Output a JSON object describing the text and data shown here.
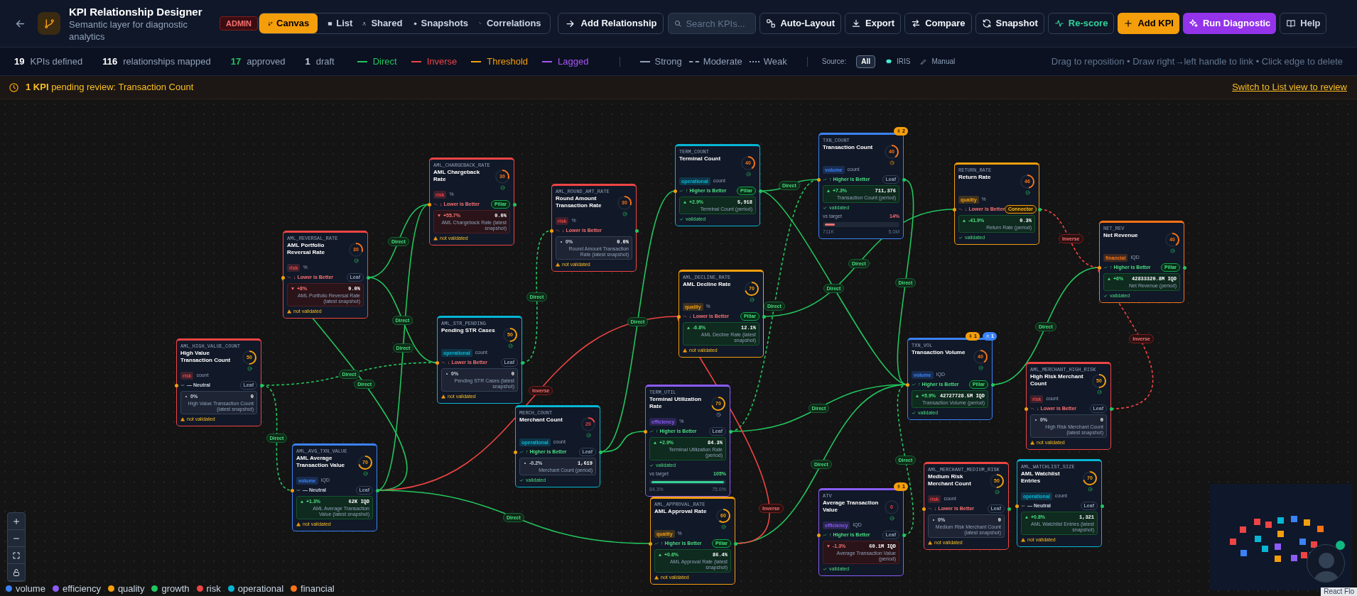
{
  "header": {
    "title": "KPI Relationship Designer",
    "subtitle": "Semantic layer for diagnostic analytics",
    "role_badge": "ADMIN",
    "tabs": [
      {
        "label": "Canvas",
        "kind": "canvas",
        "selected": true
      },
      {
        "label": "List",
        "kind": "list",
        "selected": false
      },
      {
        "label": "Shared",
        "kind": "shared",
        "selected": false
      },
      {
        "label": "Snapshots",
        "kind": "snapshots",
        "selected": false
      },
      {
        "label": "Correlations",
        "kind": "correlations",
        "selected": false
      }
    ],
    "add_relationship": "Add Relationship",
    "search": {
      "placeholder": "Search KPIs..."
    },
    "buttons": [
      {
        "label": "Auto-Layout",
        "kind": "auto_layout"
      },
      {
        "label": "Export",
        "kind": "export"
      },
      {
        "label": "Compare",
        "kind": "compare"
      },
      {
        "label": "Snapshot",
        "kind": "snapshot"
      },
      {
        "label": "Re-score",
        "kind": "rescore"
      },
      {
        "label": "Add KPI",
        "kind": "add_kpi"
      },
      {
        "label": "Run Diagnostic",
        "kind": "run_diagnostic"
      },
      {
        "label": "Help",
        "kind": "help"
      }
    ]
  },
  "stats": [
    {
      "value": "19",
      "label": "KPIs defined",
      "color": "#ffffff"
    },
    {
      "value": "116",
      "label": "relationships mapped",
      "color": "#ffffff"
    },
    {
      "value": "17",
      "label": "approved",
      "color": "#22c55e"
    },
    {
      "value": "1",
      "label": "draft",
      "color": "#cbd5e1"
    }
  ],
  "edge_types": [
    {
      "label": "Direct",
      "color": "#22c55e"
    },
    {
      "label": "Inverse",
      "color": "#ef4444"
    },
    {
      "label": "Threshold",
      "color": "#f59e0b"
    },
    {
      "label": "Lagged",
      "color": "#a855f7"
    }
  ],
  "strengths": [
    {
      "label": "Strong",
      "kind": "solid"
    },
    {
      "label": "Moderate",
      "kind": "dashed"
    },
    {
      "label": "Weak",
      "kind": "dotted"
    }
  ],
  "source": {
    "label": "Source:",
    "options": [
      {
        "label": "All",
        "kind": "all",
        "selected": true
      },
      {
        "label": "IRIS",
        "kind": "iris",
        "selected": false
      },
      {
        "label": "Manual",
        "kind": "manual",
        "selected": false
      }
    ]
  },
  "hint": "Drag to reposition • Draw right→left handle to link • Click edge to delete",
  "banner": {
    "message": "**1 KPI** pending review: Transaction Count",
    "link": "Switch to List view to review"
  },
  "nodes": [
    {
      "code": "AML_HIGH_VALUE_COUNT",
      "name": "High Value Transaction Count",
      "score": "50",
      "status": {
        "kind": "approved"
      },
      "tag": {
        "label": "risk",
        "color": "#ef4444"
      },
      "unit": "count",
      "direction": {
        "label": "— Neutral",
        "kind": "neutral"
      },
      "role": {
        "label": "Leaf",
        "kind": "leaf"
      },
      "change": {
        "label": "0%",
        "kind": "flat"
      },
      "value": "0",
      "note": "High Value Transaction Count (latest snapshot)",
      "validation": {
        "label": "not validated",
        "ok": false
      }
    },
    {
      "code": "AML_REVERSAL_RATE",
      "name": "AML Portfolio Reversal Rate",
      "score": "30",
      "status": {
        "kind": "approved"
      },
      "tag": {
        "label": "risk",
        "color": "#ef4444"
      },
      "unit": "%",
      "direction": {
        "label": "↓ Lower is Better",
        "kind": "lower"
      },
      "role": {
        "label": "Leaf",
        "kind": "leaf"
      },
      "change": {
        "label": "+8%",
        "kind": "bad"
      },
      "value": "0.0%",
      "note": "AML Portfolio Reversal Rate (latest snapshot)",
      "validation": {
        "label": "not validated",
        "ok": false
      }
    },
    {
      "code": "AML_CHARGEBACK_RATE",
      "name": "AML Chargeback Rate",
      "score": "30",
      "status": {
        "kind": "approved"
      },
      "tag": {
        "label": "risk",
        "color": "#ef4444"
      },
      "unit": "%",
      "direction": {
        "label": "↓ Lower is Better",
        "kind": "lower"
      },
      "role": {
        "label": "Pillar",
        "kind": "pillar"
      },
      "change": {
        "label": "+55.7%",
        "kind": "bad"
      },
      "value": "0.0%",
      "note": "AML Chargeback Rate (latest snapshot)",
      "validation": {
        "label": "not validated",
        "ok": false
      }
    },
    {
      "code": "AML_ROUND_AMT_RATE",
      "name": "Round Amount Transaction Rate",
      "score": "30",
      "status": {
        "kind": "approved"
      },
      "tag": {
        "label": "risk",
        "color": "#ef4444"
      },
      "unit": "%",
      "direction": {
        "label": "↓ Lower is Better",
        "kind": "lower"
      },
      "change": {
        "label": "0%",
        "kind": "flat"
      },
      "value": "0.0%",
      "note": "Round Amount Transaction Rate (latest snapshot)",
      "validation": {
        "label": "not validated",
        "ok": false
      }
    },
    {
      "code": "AML_STR_PENDING",
      "name": "Pending STR Cases",
      "score": "50",
      "status": {
        "kind": "approved"
      },
      "tag": {
        "label": "operational",
        "color": "#06b6d4"
      },
      "unit": "count",
      "direction": {
        "label": "↓ Lower is Better",
        "kind": "lower"
      },
      "role": {
        "label": "Leaf",
        "kind": "leaf"
      },
      "change": {
        "label": "0%",
        "kind": "flat"
      },
      "value": "0",
      "note": "Pending STR Cases (latest snapshot)",
      "validation": {
        "label": "not validated",
        "ok": false
      }
    },
    {
      "code": "TERM_COUNT",
      "name": "Terminal Count",
      "score": "40",
      "status": {
        "kind": "approved"
      },
      "tag": {
        "label": "operational",
        "color": "#06b6d4"
      },
      "unit": "count",
      "direction": {
        "label": "↑ Higher is Better",
        "kind": "higher"
      },
      "role": {
        "label": "Pillar",
        "kind": "pillar"
      },
      "change": {
        "label": "+2.9%",
        "kind": "good"
      },
      "value": "5,918",
      "note": "Terminal Count (period)",
      "validation": {
        "label": "validated",
        "ok": true
      }
    },
    {
      "code": "TXN_COUNT",
      "name": "Transaction Count",
      "score": "40",
      "status": {
        "kind": "review"
      },
      "badges": [
        {
          "kind": "pin",
          "count": "2"
        }
      ],
      "tag": {
        "label": "volume",
        "color": "#3b82f6"
      },
      "unit": "count",
      "direction": {
        "label": "↑ Higher is Better",
        "kind": "higher"
      },
      "role": {
        "label": "Leaf",
        "kind": "leaf"
      },
      "change": {
        "label": "+7.3%",
        "kind": "good"
      },
      "value": "711,376",
      "note": "Transaction Count (period)",
      "validation": {
        "label": "validated",
        "ok": true
      },
      "target": {
        "label": "vs target",
        "reading": "14%",
        "level": 0.14,
        "met": false,
        "min": "711K",
        "max": "5.0M"
      }
    },
    {
      "code": "RETURN_RATE",
      "name": "Return Rate",
      "score": "46",
      "status": {
        "kind": "approved"
      },
      "tag": {
        "label": "quality",
        "color": "#f59e0b"
      },
      "unit": "%",
      "direction": {
        "label": "↓ Lower is Better",
        "kind": "lower"
      },
      "role": {
        "label": "Connector",
        "kind": "connector"
      },
      "change": {
        "label": "-41.9%",
        "kind": "good"
      },
      "value": "0.3%",
      "note": "Return Rate (period)",
      "validation": {
        "label": "validated",
        "ok": true
      }
    },
    {
      "code": "NET_REV",
      "name": "Net Revenue",
      "score": "40",
      "status": {
        "kind": "approved"
      },
      "tag": {
        "label": "financial",
        "color": "#f97316"
      },
      "unit": "IQD",
      "direction": {
        "label": "↑ Higher is Better",
        "kind": "higher"
      },
      "role": {
        "label": "Pillar",
        "kind": "pillar"
      },
      "change": {
        "label": "+6%",
        "kind": "good"
      },
      "value": "42833320.8M IQD",
      "note": "Net Revenue (period)",
      "validation": {
        "label": "validated",
        "ok": true
      }
    },
    {
      "code": "AML_DECLINE_RATE",
      "name": "AML Decline Rate",
      "score": "70",
      "status": {
        "kind": "approved"
      },
      "tag": {
        "label": "quality",
        "color": "#f59e0b"
      },
      "unit": "%",
      "direction": {
        "label": "↓ Lower is Better",
        "kind": "lower"
      },
      "role": {
        "label": "Pillar",
        "kind": "pillar"
      },
      "change": {
        "label": "-6.8%",
        "kind": "good"
      },
      "value": "12.1%",
      "note": "AML Decline Rate (latest snapshot)",
      "validation": {
        "label": "not validated",
        "ok": false
      }
    },
    {
      "code": "TXN_VOL",
      "name": "Transaction Volume",
      "score": "40",
      "status": {
        "kind": "approved"
      },
      "badges": [
        {
          "kind": "pin",
          "count": "1"
        },
        {
          "kind": "user",
          "count": "1"
        }
      ],
      "tag": {
        "label": "volume",
        "color": "#3b82f6"
      },
      "unit": "IQD",
      "direction": {
        "label": "↑ Higher is Better",
        "kind": "higher"
      },
      "role": {
        "label": "Pillar",
        "kind": "pillar"
      },
      "change": {
        "label": "+5.9%",
        "kind": "good"
      },
      "value": "42727728.5M IQD",
      "note": "Transaction Volume (period)",
      "validation": {
        "label": "validated",
        "ok": true
      }
    },
    {
      "code": "AML_MERCHANT_HIGH_RISK",
      "name": "High Risk Merchant Count",
      "score": "50",
      "status": {
        "kind": "approved"
      },
      "tag": {
        "label": "risk",
        "color": "#ef4444"
      },
      "unit": "count",
      "direction": {
        "label": "↓ Lower is Better",
        "kind": "lower"
      },
      "role": {
        "label": "Leaf",
        "kind": "leaf"
      },
      "change": {
        "label": "0%",
        "kind": "flat"
      },
      "value": "0",
      "note": "High Risk Merchant Count (latest snapshot)",
      "validation": {
        "label": "not validated",
        "ok": false
      }
    },
    {
      "code": "MERCH_COUNT",
      "name": "Merchant Count",
      "score": "20",
      "status": {
        "kind": "approved"
      },
      "tag": {
        "label": "operational",
        "color": "#06b6d4"
      },
      "unit": "count",
      "direction": {
        "label": "↑ Higher is Better",
        "kind": "higher"
      },
      "role": {
        "label": "Leaf",
        "kind": "leaf"
      },
      "change": {
        "label": "-0.2%",
        "kind": "flat"
      },
      "value": "1,619",
      "note": "Merchant Count (period)",
      "validation": {
        "label": "validated",
        "ok": true
      }
    },
    {
      "code": "TERM_UTIL",
      "name": "Terminal Utilization Rate",
      "score": "70",
      "status": {
        "kind": "draft"
      },
      "tag": {
        "label": "efficiency",
        "color": "#8b5cf6"
      },
      "unit": "%",
      "direction": {
        "label": "↑ Higher is Better",
        "kind": "higher"
      },
      "role": {
        "label": "Leaf",
        "kind": "leaf"
      },
      "change": {
        "label": "+2.9%",
        "kind": "good"
      },
      "value": "84.3%",
      "note": "Terminal Utilization Rate (period)",
      "validation": {
        "label": "validated",
        "ok": true
      },
      "target": {
        "label": "vs target",
        "reading": "105%",
        "level": 1,
        "met": true,
        "min": "84.3%",
        "max": "75.0%"
      }
    },
    {
      "code": "AML_AVG_TXN_VALUE",
      "name": "AML Average Transaction Value",
      "score": "70",
      "status": {
        "kind": "approved"
      },
      "tag": {
        "label": "volume",
        "color": "#3b82f6"
      },
      "unit": "IQD",
      "direction": {
        "label": "— Neutral",
        "kind": "neutral"
      },
      "role": {
        "label": "Leaf",
        "kind": "leaf"
      },
      "change": {
        "label": "+1.3%",
        "kind": "good"
      },
      "value": "62K IQD",
      "note": "AML Average Transaction Value (latest snapshot)",
      "validation": {
        "label": "not validated",
        "ok": false
      }
    },
    {
      "code": "AML_APPROVAL_RATE",
      "name": "AML Approval Rate",
      "score": "60",
      "status": {
        "kind": "approved"
      },
      "tag": {
        "label": "quality",
        "color": "#f59e0b"
      },
      "unit": "%",
      "direction": {
        "label": "↑ Higher is Better",
        "kind": "higher"
      },
      "role": {
        "label": "Pillar",
        "kind": "pillar"
      },
      "change": {
        "label": "+0.6%",
        "kind": "good"
      },
      "value": "86.4%",
      "note": "AML Approval Rate (latest snapshot)",
      "validation": {
        "label": "not validated",
        "ok": false
      }
    },
    {
      "code": "ATV",
      "name": "Average Transaction Value",
      "score": "0",
      "status": {
        "kind": "approved"
      },
      "badges": [
        {
          "kind": "pin",
          "count": "1"
        }
      ],
      "tag": {
        "label": "efficiency",
        "color": "#8b5cf6"
      },
      "unit": "IQD",
      "direction": {
        "label": "↑ Higher is Better",
        "kind": "higher"
      },
      "role": {
        "label": "Leaf",
        "kind": "leaf"
      },
      "change": {
        "label": "-1.3%",
        "kind": "bad"
      },
      "value": "60.1M IQD",
      "note": "Average Transaction Value (period)",
      "validation": {
        "label": "validated",
        "ok": true
      }
    },
    {
      "code": "AML_MERCHANT_MEDIUM_RISK",
      "name": "Medium Risk Merchant Count",
      "score": "50",
      "status": {
        "kind": "approved"
      },
      "tag": {
        "label": "risk",
        "color": "#ef4444"
      },
      "unit": "count",
      "direction": {
        "label": "↓ Lower is Better",
        "kind": "lower"
      },
      "role": {
        "label": "Leaf",
        "kind": "leaf"
      },
      "change": {
        "label": "0%",
        "kind": "flat"
      },
      "value": "0",
      "note": "Medium Risk Merchant Count (latest snapshot)",
      "validation": {
        "label": "not validated",
        "ok": false
      }
    },
    {
      "code": "AML_WATCHLIST_SIZE",
      "name": "AML Watchlist Entries",
      "score": "70",
      "status": {
        "kind": "approved"
      },
      "tag": {
        "label": "operational",
        "color": "#06b6d4"
      },
      "unit": "count",
      "direction": {
        "label": "— Neutral",
        "kind": "neutral"
      },
      "role": {
        "label": "Leaf",
        "kind": "leaf"
      },
      "change": {
        "label": "+0.8%",
        "kind": "good"
      },
      "value": "1,321",
      "note": "AML Watchlist Entries (latest snapshot)",
      "validation": {
        "label": "not validated",
        "ok": false
      }
    }
  ],
  "edges": [
    {
      "label": "Direct",
      "kind": "direct",
      "dashed": false
    },
    {
      "label": "Direct",
      "kind": "direct",
      "dashed": false
    },
    {
      "label": "Direct",
      "kind": "direct",
      "dashed": false
    },
    {
      "label": "Direct",
      "kind": "direct",
      "dashed": true
    },
    {
      "label": "Direct",
      "kind": "direct",
      "dashed": false
    },
    {
      "label": "Direct",
      "kind": "direct",
      "dashed": true
    },
    {
      "label": "Direct",
      "kind": "direct",
      "dashed": true
    },
    {
      "label": "Inverse",
      "kind": "inverse",
      "dashed": false
    },
    {
      "label": "Direct",
      "kind": "direct",
      "dashed": false
    },
    {
      "label": "Direct",
      "kind": "direct",
      "dashed": false
    },
    {
      "kind": "direct",
      "dashed": false
    },
    {
      "label": "Direct",
      "kind": "direct",
      "dashed": false
    },
    {
      "label": "Direct",
      "kind": "direct",
      "dashed": false
    },
    {
      "label": "Direct",
      "kind": "direct",
      "dashed": false
    },
    {
      "label": "Direct",
      "kind": "direct",
      "dashed": true
    },
    {
      "label": "Direct",
      "kind": "direct",
      "dashed": false
    },
    {
      "label": "Direct",
      "kind": "direct",
      "dashed": false
    },
    {
      "label": "Inverse",
      "kind": "inverse",
      "dashed": true
    },
    {
      "label": "Inverse",
      "kind": "inverse",
      "dashed": true
    },
    {
      "label": "Direct",
      "kind": "direct",
      "dashed": false
    },
    {
      "label": "Direct",
      "kind": "direct",
      "dashed": true
    },
    {
      "label": "Direct",
      "kind": "direct",
      "dashed": false
    },
    {
      "label": "Inverse",
      "kind": "inverse",
      "dashed": false
    }
  ],
  "legend": [
    {
      "label": "volume",
      "color": "#3b82f6"
    },
    {
      "label": "efficiency",
      "color": "#8b5cf6"
    },
    {
      "label": "quality",
      "color": "#f59e0b"
    },
    {
      "label": "growth",
      "color": "#22c55e"
    },
    {
      "label": "risk",
      "color": "#ef4444"
    },
    {
      "label": "operational",
      "color": "#06b6d4"
    },
    {
      "label": "financial",
      "color": "#f97316"
    }
  ],
  "attribution": "React Flo"
}
